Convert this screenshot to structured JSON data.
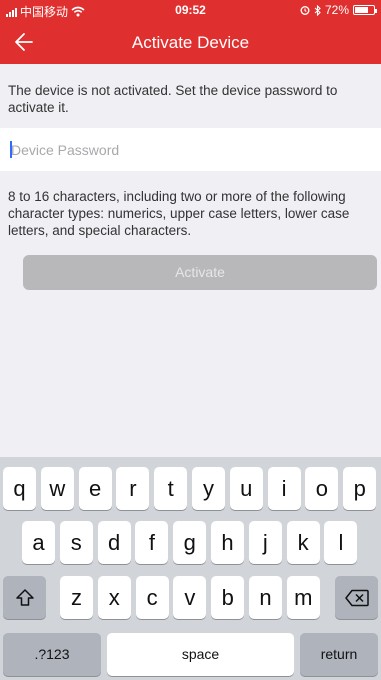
{
  "status_bar": {
    "carrier": "中国移动",
    "time": "09:52",
    "battery": "72%",
    "battery_level": 0.72
  },
  "nav": {
    "title": "Activate Device"
  },
  "notice": "The device is not activated. Set the device password to activate it.",
  "password": {
    "placeholder": "Device Password",
    "value": ""
  },
  "rules": "8 to 16 characters, including two or more of the following character types: numerics, upper case letters, lower case letters, and special characters.",
  "activate_label": "Activate",
  "keyboard": {
    "row1": [
      "q",
      "w",
      "e",
      "r",
      "t",
      "y",
      "u",
      "i",
      "o",
      "p"
    ],
    "row2": [
      "a",
      "s",
      "d",
      "f",
      "g",
      "h",
      "j",
      "k",
      "l"
    ],
    "row3": [
      "z",
      "x",
      "c",
      "v",
      "b",
      "n",
      "m"
    ],
    "shift_icon": "shift-icon",
    "backspace_icon": "backspace-icon",
    "numbers_label": ".?123",
    "space_label": "space",
    "return_label": "return"
  },
  "colors": {
    "brand": "#e02f2f",
    "background": "#efeff4",
    "button_disabled": "#b8b8bb",
    "keyboard": "#d1d4d9"
  }
}
